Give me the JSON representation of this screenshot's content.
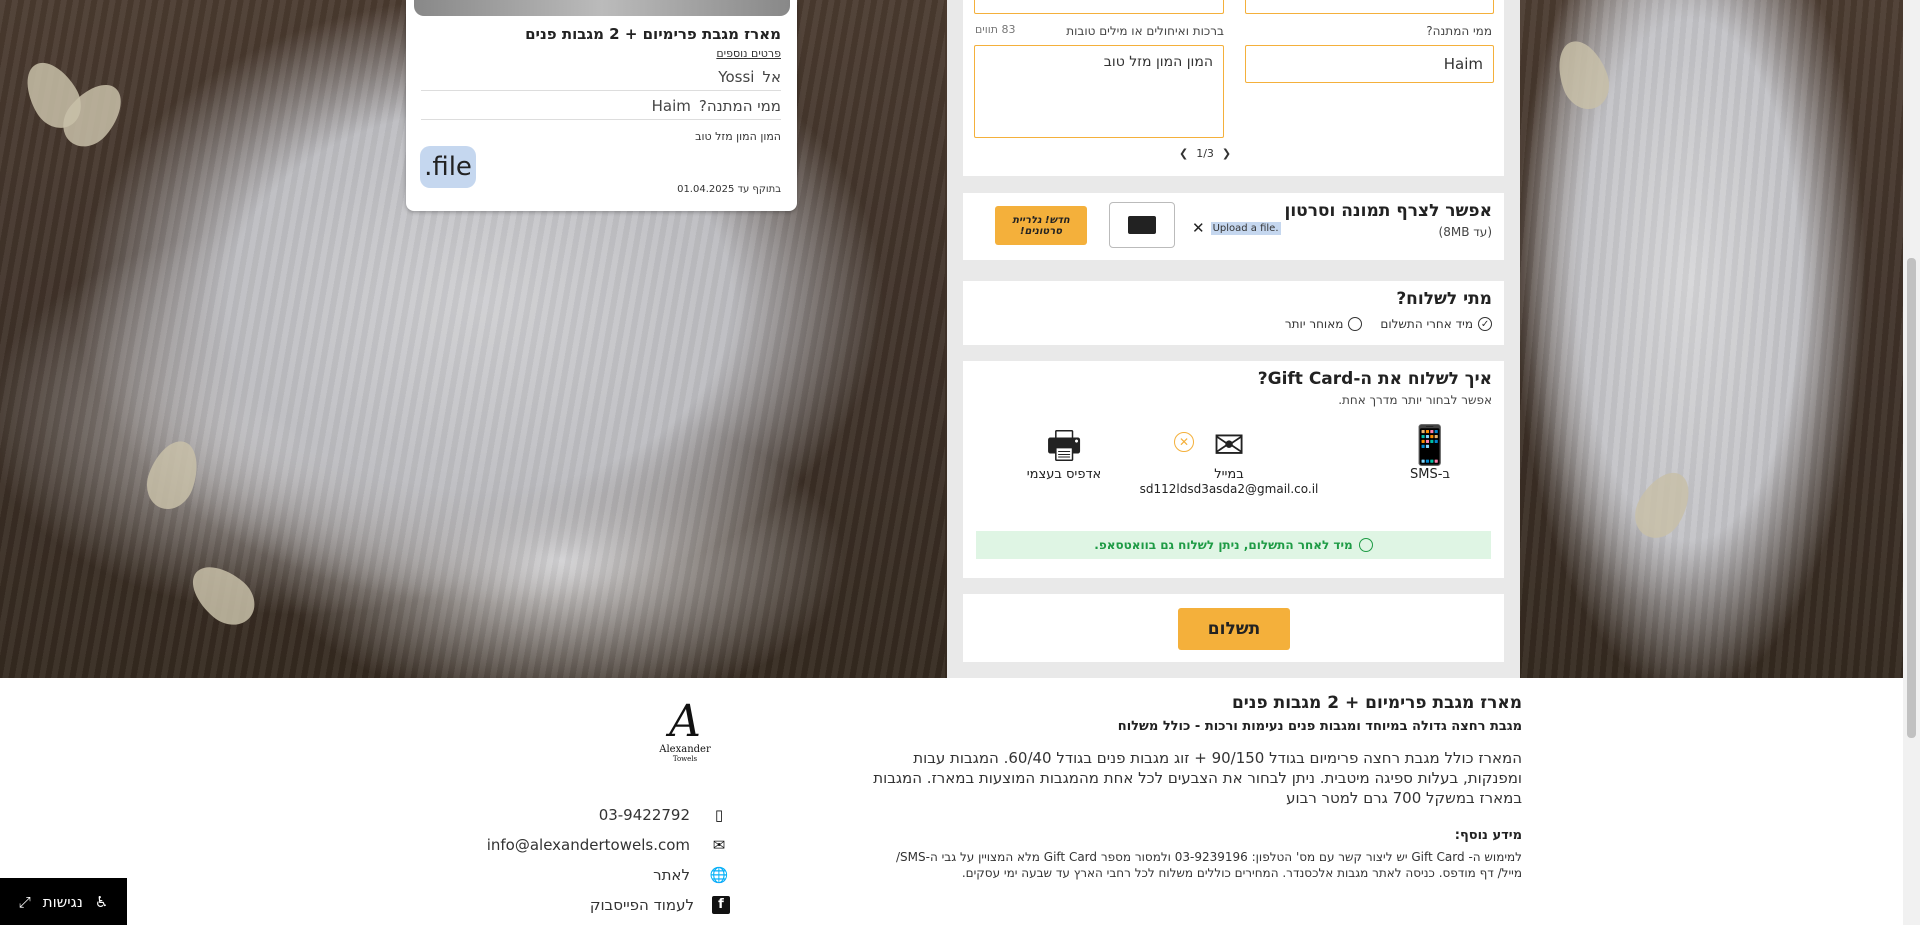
{
  "preview": {
    "title": "מארז מגבת פרימיום + 2 מגבות פנים",
    "more_details": "פרטים נוספים",
    "to_label": "אל",
    "to_value": "Yossi",
    "from_label": "ממי המתנה?",
    "from_value": "Haim",
    "message": "המון המון מזל טוב",
    "file_label": "file.",
    "valid_label": "בתוקף עד",
    "valid_date": "01.04.2025"
  },
  "form": {
    "from_label": "ממי המתנה?",
    "from_value": "Haim",
    "greeting_label": "ברכות ואיחולים או מילים טובות",
    "greeting_counter": "83 תווים",
    "greeting_value": "המון המון מזל טוב",
    "pager": "1/3",
    "upload": {
      "title": "אפשר לצרף תמונה וסרטון",
      "subtitle": "(עד 8MB)",
      "file_label": "Upload a file.",
      "new_badge": "חדש! גלריית סרטונים!"
    },
    "when": {
      "title": "מתי לשלוח?",
      "opt_now": "מיד אחרי התשלום",
      "opt_later": "מאוחר יותר"
    },
    "how": {
      "title": "איך לשלוח את ה-Gift Card?",
      "subtitle": "אפשר לבחור יותר מדרך אחת.",
      "sms_label": "ב-SMS",
      "mail_label": "במייל",
      "mail_value": "sd112ldsd3asda2@gmail.co.il",
      "print_label": "אדפיס בעצמי",
      "whatsapp_note": "מיד לאחר התשלום, ניתן לשלוח גם בוואטסאפ."
    },
    "pay_label": "תשלום"
  },
  "footer": {
    "title": "מארז מגבת פרימיום + 2 מגבות פנים",
    "subtitle": "מגבת רחצה גדולה במיוחד ומגבות פנים נעימות ורכות - כולל משלוח",
    "body": "המארז כולל מגבת רחצה פרימיום בגודל 90/150 + זוג מגבות פנים בגודל 60/40. המגבות עבות ומפנקות, בעלות ספיגה מיטבית. ניתן לבחור את הצבעים לכל אחת מהמגבות המוצעות במארז. המגבות במארז במשקל 700 גרם למטר רבוע",
    "more_title": "מידע נוסף:",
    "more_body": "למימוש ה- Gift Card יש ליצור קשר עם מס' הטלפון: 03-9239196 ולמסור מספר Gift Card מלא המצויין על גבי ה-SMS/ מייל/ דף מודפס. כניסה לאתר מגבות אלכסנדר. המחירים כוללים משלוח לכל רחבי הארץ עד שבעה ימי עסקים.",
    "logo_name": "Alexander",
    "logo_sub": "Towels",
    "phone": "03-9422792",
    "email": "info@alexandertowels.com",
    "website": "לאתר",
    "facebook": "לעמוד הפייסבוק"
  },
  "accessibility_label": "נגישות"
}
